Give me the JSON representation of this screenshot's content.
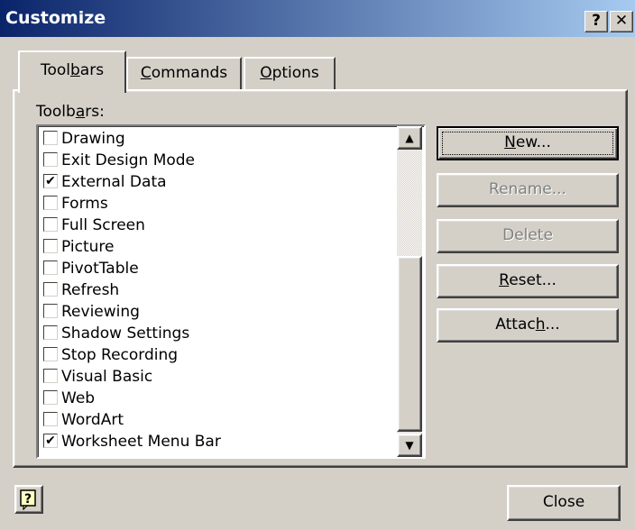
{
  "window": {
    "title": "Customize",
    "help_button": "?",
    "close_button": "✕"
  },
  "tabs": [
    {
      "pre": "Tool",
      "u": "b",
      "post": "ars"
    },
    {
      "pre": "",
      "u": "C",
      "post": "ommands"
    },
    {
      "pre": "",
      "u": "O",
      "post": "ptions"
    }
  ],
  "toolbars_label": {
    "pre": "Toolb",
    "u": "a",
    "post": "rs:"
  },
  "toolbars": [
    {
      "label": "Drawing",
      "checked": false
    },
    {
      "label": "Exit Design Mode",
      "checked": false
    },
    {
      "label": "External Data",
      "checked": true
    },
    {
      "label": "Forms",
      "checked": false
    },
    {
      "label": "Full Screen",
      "checked": false
    },
    {
      "label": "Picture",
      "checked": false
    },
    {
      "label": "PivotTable",
      "checked": false
    },
    {
      "label": "Refresh",
      "checked": false
    },
    {
      "label": "Reviewing",
      "checked": false
    },
    {
      "label": "Shadow Settings",
      "checked": false
    },
    {
      "label": "Stop Recording",
      "checked": false
    },
    {
      "label": "Visual Basic",
      "checked": false
    },
    {
      "label": "Web",
      "checked": false
    },
    {
      "label": "WordArt",
      "checked": false
    },
    {
      "label": "Worksheet Menu Bar",
      "checked": true
    }
  ],
  "buttons": {
    "new": {
      "pre": "",
      "u": "N",
      "post": "ew..."
    },
    "rename": "Rename...",
    "delete": "Delete",
    "reset": {
      "pre": "",
      "u": "R",
      "post": "eset..."
    },
    "attach": {
      "pre": "Attac",
      "u": "h",
      "post": "..."
    },
    "close": "Close"
  },
  "icons": {
    "help": "help-icon",
    "check": "✔",
    "scroll_up": "▲",
    "scroll_down": "▼"
  }
}
